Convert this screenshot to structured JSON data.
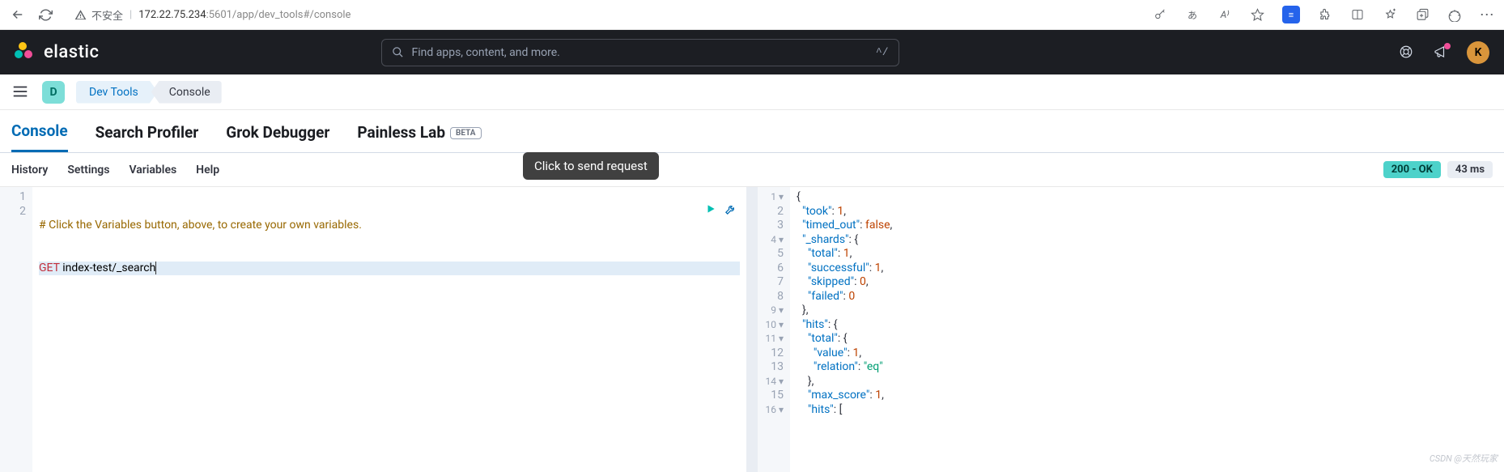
{
  "browser": {
    "insecure_label": "不安全",
    "url_prefix": "172.22.75.234",
    "url_suffix": ":5601/app/dev_tools#/console"
  },
  "kibana": {
    "brand": "elastic",
    "search_placeholder": "Find apps, content, and more.",
    "search_shortcut": "^/",
    "avatar_initial": "K"
  },
  "breadcrumb": {
    "space_initial": "D",
    "first": "Dev Tools",
    "last": "Console"
  },
  "tabs": {
    "console": "Console",
    "search_profiler": "Search Profiler",
    "grok_debugger": "Grok Debugger",
    "painless_lab": "Painless Lab",
    "beta_badge": "BETA"
  },
  "toolbar": {
    "history": "History",
    "settings": "Settings",
    "variables": "Variables",
    "help": "Help",
    "status_label": "200 - OK",
    "timing": "43 ms"
  },
  "tooltip": {
    "send_request": "Click to send request"
  },
  "request": {
    "comment": "# Click the Variables button, above, to create your own variables.",
    "method": "GET",
    "path": "index-test/_search"
  },
  "response_lines": [
    {
      "n": "1",
      "fold": true,
      "tokens": [
        [
          "punc",
          "{"
        ]
      ]
    },
    {
      "n": "2",
      "tokens": [
        [
          "pad",
          "  "
        ],
        [
          "key",
          "\"took\""
        ],
        [
          "punc",
          ": "
        ],
        [
          "num",
          "1"
        ],
        [
          "punc",
          ","
        ]
      ]
    },
    {
      "n": "3",
      "tokens": [
        [
          "pad",
          "  "
        ],
        [
          "key",
          "\"timed_out\""
        ],
        [
          "punc",
          ": "
        ],
        [
          "bool",
          "false"
        ],
        [
          "punc",
          ","
        ]
      ]
    },
    {
      "n": "4",
      "fold": true,
      "tokens": [
        [
          "pad",
          "  "
        ],
        [
          "key",
          "\"_shards\""
        ],
        [
          "punc",
          ": {"
        ]
      ]
    },
    {
      "n": "5",
      "tokens": [
        [
          "pad",
          "    "
        ],
        [
          "key",
          "\"total\""
        ],
        [
          "punc",
          ": "
        ],
        [
          "num",
          "1"
        ],
        [
          "punc",
          ","
        ]
      ]
    },
    {
      "n": "6",
      "tokens": [
        [
          "pad",
          "    "
        ],
        [
          "key",
          "\"successful\""
        ],
        [
          "punc",
          ": "
        ],
        [
          "num",
          "1"
        ],
        [
          "punc",
          ","
        ]
      ]
    },
    {
      "n": "7",
      "tokens": [
        [
          "pad",
          "    "
        ],
        [
          "key",
          "\"skipped\""
        ],
        [
          "punc",
          ": "
        ],
        [
          "num",
          "0"
        ],
        [
          "punc",
          ","
        ]
      ]
    },
    {
      "n": "8",
      "tokens": [
        [
          "pad",
          "    "
        ],
        [
          "key",
          "\"failed\""
        ],
        [
          "punc",
          ": "
        ],
        [
          "num",
          "0"
        ]
      ]
    },
    {
      "n": "9",
      "fold": true,
      "tokens": [
        [
          "pad",
          "  "
        ],
        [
          "punc",
          "},"
        ]
      ]
    },
    {
      "n": "10",
      "fold": true,
      "tokens": [
        [
          "pad",
          "  "
        ],
        [
          "key",
          "\"hits\""
        ],
        [
          "punc",
          ": {"
        ]
      ]
    },
    {
      "n": "11",
      "fold": true,
      "tokens": [
        [
          "pad",
          "    "
        ],
        [
          "key",
          "\"total\""
        ],
        [
          "punc",
          ": {"
        ]
      ]
    },
    {
      "n": "12",
      "tokens": [
        [
          "pad",
          "      "
        ],
        [
          "key",
          "\"value\""
        ],
        [
          "punc",
          ": "
        ],
        [
          "num",
          "1"
        ],
        [
          "punc",
          ","
        ]
      ]
    },
    {
      "n": "13",
      "tokens": [
        [
          "pad",
          "      "
        ],
        [
          "key",
          "\"relation\""
        ],
        [
          "punc",
          ": "
        ],
        [
          "str",
          "\"eq\""
        ]
      ]
    },
    {
      "n": "14",
      "fold": true,
      "tokens": [
        [
          "pad",
          "    "
        ],
        [
          "punc",
          "},"
        ]
      ]
    },
    {
      "n": "15",
      "tokens": [
        [
          "pad",
          "    "
        ],
        [
          "key",
          "\"max_score\""
        ],
        [
          "punc",
          ": "
        ],
        [
          "num",
          "1"
        ],
        [
          "punc",
          ","
        ]
      ]
    },
    {
      "n": "16",
      "fold": true,
      "tokens": [
        [
          "pad",
          "    "
        ],
        [
          "key",
          "\"hits\""
        ],
        [
          "punc",
          ": ["
        ]
      ]
    }
  ],
  "watermark": "CSDN @天然玩家"
}
